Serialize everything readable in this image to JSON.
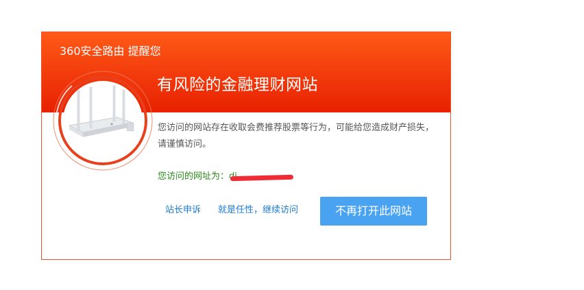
{
  "header": {
    "brand": "360安全路由 提醒您",
    "risk_title": "有风险的金融理财网站"
  },
  "message": {
    "text": "您访问的网站存在收取会费推荐股票等行为，可能给您造成财产损失，请谨慎访问。"
  },
  "url": {
    "label": "您访问的网址为：",
    "value": "di"
  },
  "actions": {
    "appeal_label": "站长申诉",
    "continue_label": "就是任性，继续访问",
    "block_label": "不再打开此网站"
  },
  "colors": {
    "header_gradient_top": "#ff5a16",
    "header_gradient_bottom": "#e82100",
    "link": "#1b7ad2",
    "url_label": "#2a8a1a",
    "primary_button": "#4aa3f0",
    "redaction": "#ef2b35"
  },
  "icons": {
    "badge": "router-icon"
  }
}
